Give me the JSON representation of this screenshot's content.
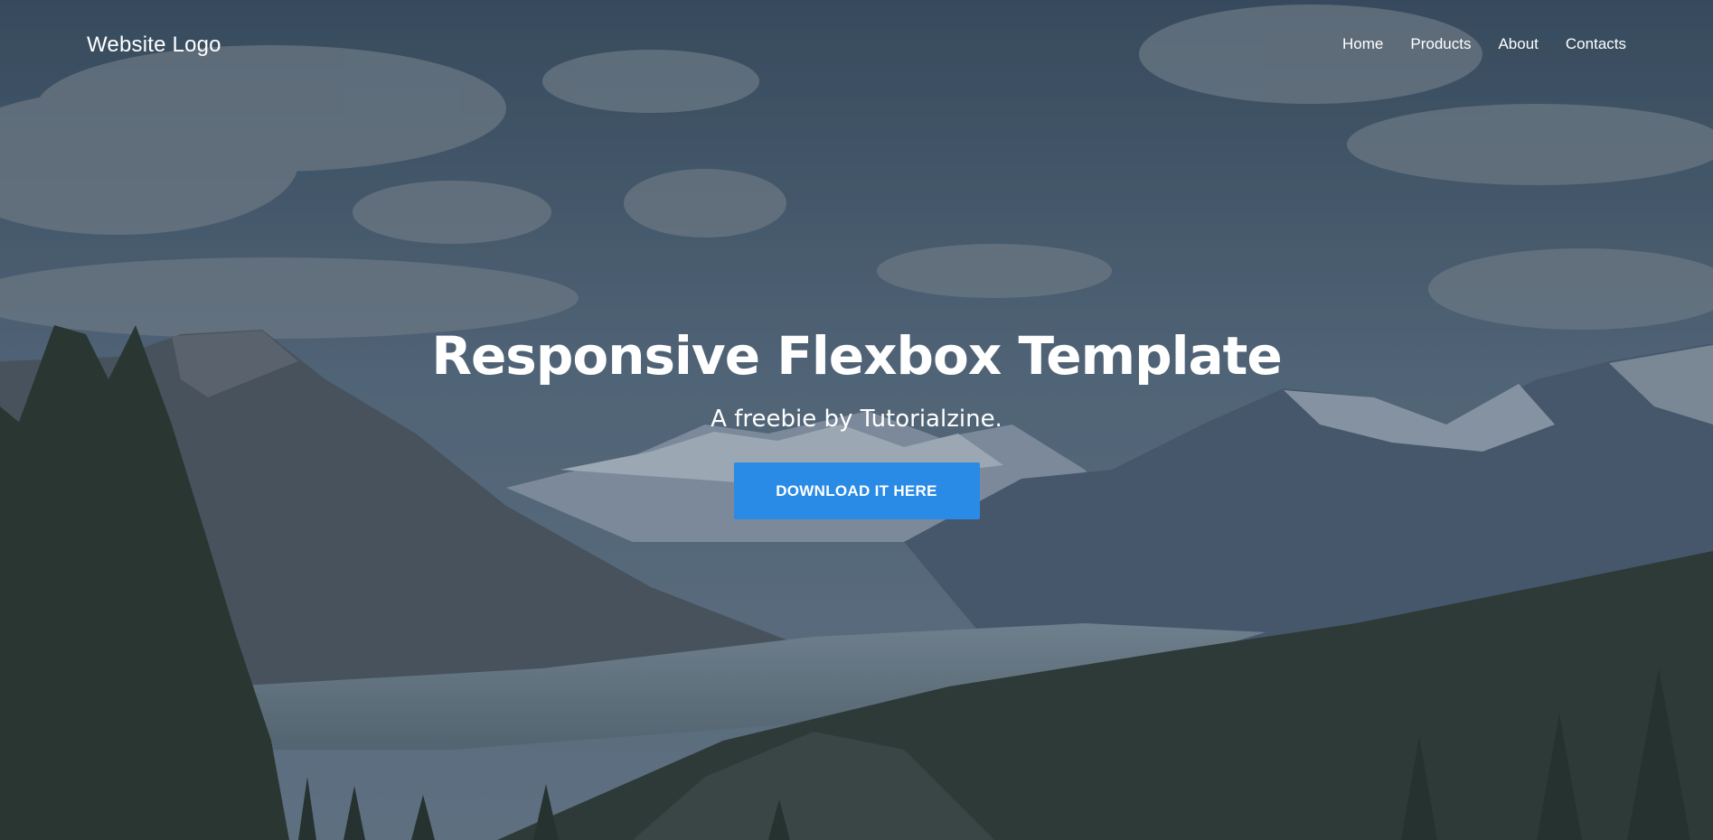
{
  "header": {
    "logo_text": "Website Logo",
    "nav": [
      "Home",
      "Products",
      "About",
      "Contacts"
    ]
  },
  "hero": {
    "title": "Responsive Flexbox Template",
    "subtitle": "A freebie by Tutorialzine.",
    "cta_label": "DOWNLOAD IT HERE"
  },
  "colors": {
    "cta_background": "#2a8be6",
    "text": "#ffffff",
    "sky_overlay": "#3d5063"
  }
}
